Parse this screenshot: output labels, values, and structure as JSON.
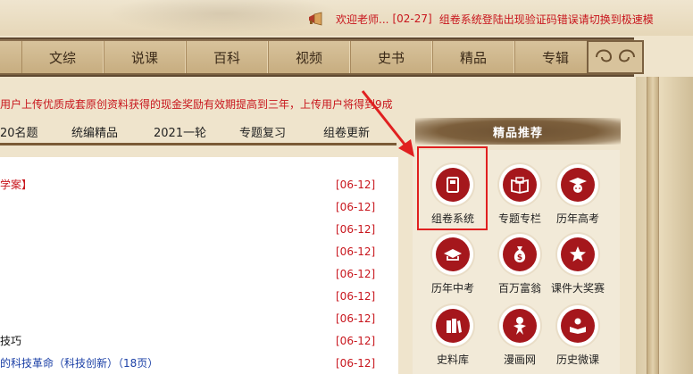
{
  "notice": {
    "welcome": "欢迎老师...",
    "date": "[02-27]",
    "announcement": "组卷系统登陆出现验证码错误请切换到极速模"
  },
  "nav": {
    "items": [
      "文综",
      "说课",
      "百科",
      "视频",
      "史书",
      "精品",
      "专辑"
    ]
  },
  "promo": {
    "text": "用户上传优质成套原创资料获得的现金奖励有效期提高到三年，上传用户将得到9成"
  },
  "subtabs": [
    "20名题",
    "统编精品",
    "2021一轮",
    "专题复习",
    "组卷更新"
  ],
  "list": {
    "rows": [
      {
        "title": "学案】",
        "style": "red",
        "date": "[06-12]"
      },
      {
        "title": "",
        "style": "",
        "date": "[06-12]"
      },
      {
        "title": "",
        "style": "",
        "date": "[06-12]"
      },
      {
        "title": "",
        "style": "",
        "date": "[06-12]"
      },
      {
        "title": "",
        "style": "",
        "date": "[06-12]"
      },
      {
        "title": "",
        "style": "",
        "date": "[06-12]"
      },
      {
        "title": "",
        "style": "",
        "date": "[06-12]"
      },
      {
        "title": "技巧",
        "style": "",
        "date": "[06-12]"
      },
      {
        "title": "的科技革命（科技创新）（18页）",
        "style": "blue",
        "date": "[06-12]"
      }
    ]
  },
  "jingpin": {
    "header": "精品推荐",
    "items": [
      {
        "label": "组卷系统",
        "icon": "book-icon"
      },
      {
        "label": "专题专栏",
        "icon": "open-book-icon"
      },
      {
        "label": "历年高考",
        "icon": "graduation-cap-icon"
      },
      {
        "label": "历年中考",
        "icon": "hat-icon"
      },
      {
        "label": "百万富翁",
        "icon": "money-bag-icon"
      },
      {
        "label": "课件大奖赛",
        "icon": "star-hand-icon"
      },
      {
        "label": "史料库",
        "icon": "books-icon"
      },
      {
        "label": "漫画网",
        "icon": "figure-icon"
      },
      {
        "label": "历史微课",
        "icon": "reader-icon"
      }
    ]
  },
  "colors": {
    "accent_red": "#c8161d",
    "icon_red": "#a5171c",
    "nav_brown": "#7a6040",
    "highlight": "#e02020"
  }
}
